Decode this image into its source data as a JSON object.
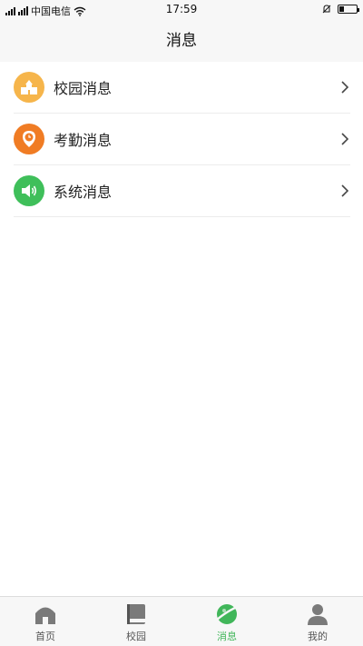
{
  "status": {
    "carrier": "中国电信",
    "time": "17:59"
  },
  "header": {
    "title": "消息"
  },
  "messages": [
    {
      "label": "校园消息",
      "icon": "school-building-icon",
      "color": "#f6b54b"
    },
    {
      "label": "考勤消息",
      "icon": "clock-pin-icon",
      "color": "#f07c24"
    },
    {
      "label": "系统消息",
      "icon": "speaker-icon",
      "color": "#3fbf5a"
    }
  ],
  "tabbar": [
    {
      "label": "首页",
      "icon": "home-icon",
      "active": false
    },
    {
      "label": "校园",
      "icon": "book-icon",
      "active": false
    },
    {
      "label": "消息",
      "icon": "planet-icon",
      "active": true
    },
    {
      "label": "我的",
      "icon": "person-icon",
      "active": false
    }
  ],
  "colors": {
    "accent": "#41b65a",
    "inactive_icon": "#7a7a7a"
  }
}
